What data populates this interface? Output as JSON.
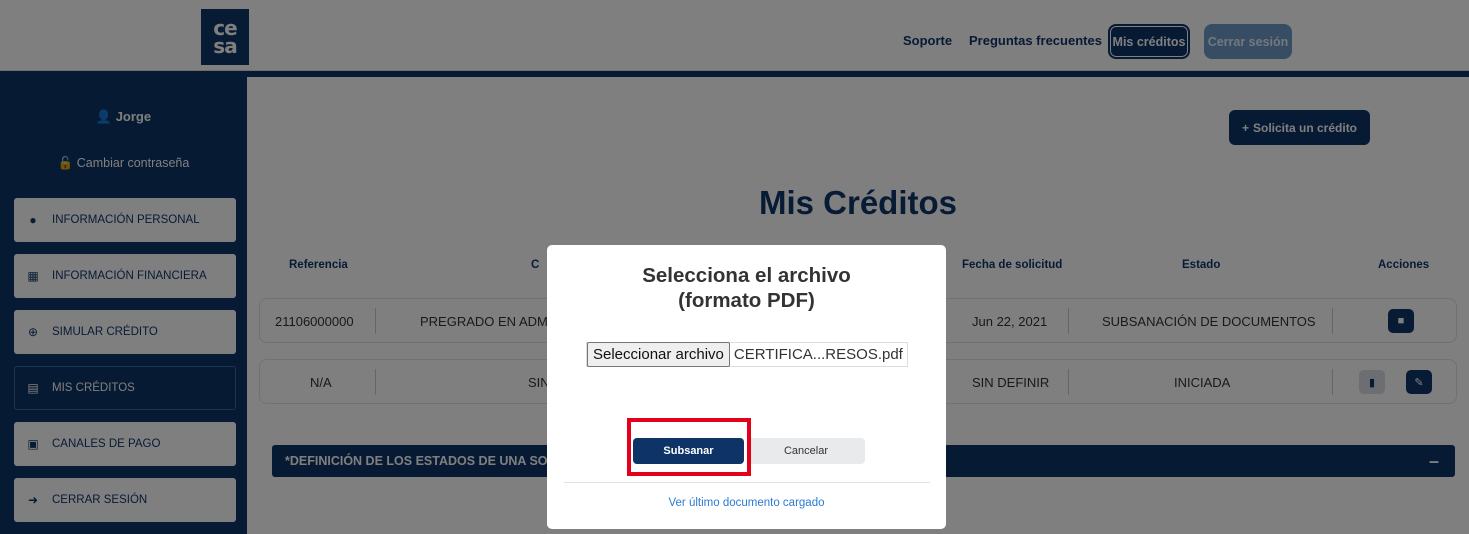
{
  "header": {
    "logo_top": "ce",
    "logo_bottom": "sa",
    "nav": {
      "soporte": "Soporte",
      "preguntas": "Preguntas frecuentes",
      "mis_creditos": "Mis créditos",
      "cerrar_sesion": "Cerrar sesión"
    }
  },
  "sidebar": {
    "user": "Jorge",
    "change_password": "Cambiar contraseña",
    "items": [
      {
        "label": "INFORMACIÓN PERSONAL",
        "icon": "user-icon"
      },
      {
        "label": "INFORMACIÓN FINANCIERA",
        "icon": "file-icon"
      },
      {
        "label": "SIMULAR CRÉDITO",
        "icon": "search-plus-icon"
      },
      {
        "label": "MIS CRÉDITOS",
        "icon": "credit-card-icon"
      },
      {
        "label": "CANALES DE PAGO",
        "icon": "cart-icon"
      },
      {
        "label": "CERRAR SESIÓN",
        "icon": "sign-out-icon"
      }
    ]
  },
  "main": {
    "request_button": "Solicita un crédito",
    "title": "Mis Créditos",
    "table": {
      "headers": {
        "referencia": "Referencia",
        "c": "C",
        "fecha": "Fecha de solicitud",
        "estado": "Estado",
        "acciones": "Acciones"
      },
      "rows": [
        {
          "referencia": "21106000000",
          "programa": "PREGRADO EN ADMIN",
          "fecha": "Jun 22, 2021",
          "estado": "SUBSANACIÓN DE DOCUMENTOS"
        },
        {
          "referencia": "N/A",
          "programa": "SIN",
          "fecha": "SIN DEFINIR",
          "estado": "INICIADA"
        }
      ]
    },
    "definitions_bar": "*DEFINICIÓN DE LOS ESTADOS DE UNA SOL"
  },
  "modal": {
    "title_line1": "Selecciona el archivo",
    "title_line2": "(formato PDF)",
    "file_button": "Seleccionar archivo",
    "file_name": "CERTIFICA...RESOS.pdf",
    "submit": "Subsanar",
    "cancel": "Cancelar",
    "last_doc_link": "Ver último documento cargado"
  },
  "colors": {
    "brand_dark": "#0e3467",
    "brand_light": "#6f9bc9",
    "highlight": "#e3001b",
    "link": "#2a7bd1"
  }
}
